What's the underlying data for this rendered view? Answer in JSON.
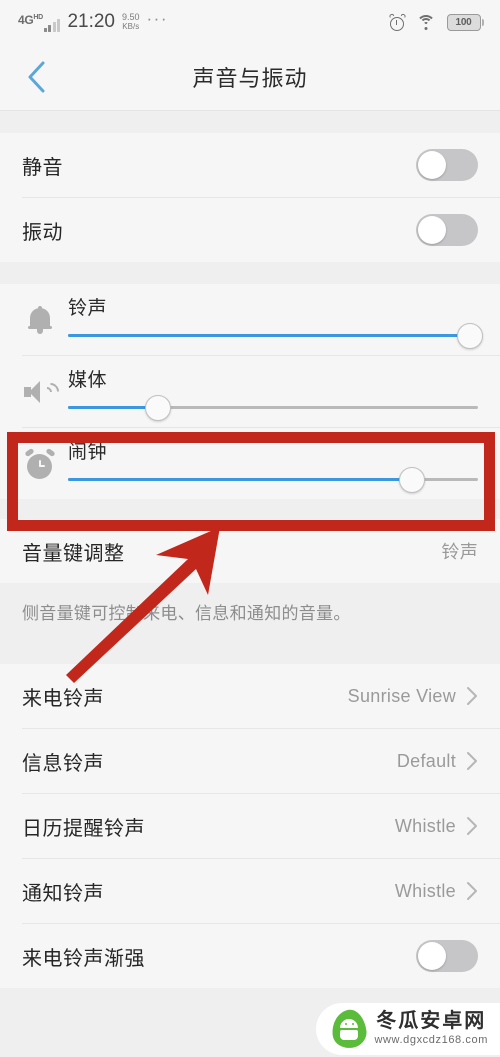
{
  "status_bar": {
    "network_type": "4G",
    "network_type_sup": "HD",
    "time": "21:20",
    "net_speed_value": "9.50",
    "net_speed_unit": "KB/s",
    "overflow_dots": "···",
    "alarm_icon": "alarm-icon",
    "wifi_icon": "wifi-icon",
    "battery_percent": "100"
  },
  "header": {
    "back_icon": "chevron-left-icon",
    "title": "声音与振动"
  },
  "toggles_group": [
    {
      "label": "静音",
      "state": "off"
    },
    {
      "label": "振动",
      "state": "off"
    }
  ],
  "sliders_group": [
    {
      "icon": "bell-icon",
      "label": "铃声",
      "percent": 98
    },
    {
      "icon": "speaker-icon",
      "label": "媒体",
      "percent": 22
    },
    {
      "icon": "alarm-clock-icon",
      "label": "闹钟",
      "percent": 84
    }
  ],
  "volume_key": {
    "label": "音量键调整",
    "value": "铃声",
    "description": "侧音量键可控制来电、信息和通知的音量。"
  },
  "ringtone_rows": [
    {
      "label": "来电铃声",
      "value": "Sunrise View",
      "chevron": "chevron-right-icon"
    },
    {
      "label": "信息铃声",
      "value": "Default",
      "chevron": "chevron-right-icon"
    },
    {
      "label": "日历提醒铃声",
      "value": "Whistle",
      "chevron": "chevron-right-icon"
    },
    {
      "label": "通知铃声",
      "value": "Whistle",
      "chevron": "chevron-right-icon"
    }
  ],
  "last_toggle": {
    "label": "来电铃声渐强",
    "state": "off"
  },
  "annotation": {
    "highlight_color": "#c1271a",
    "target": "闹钟",
    "arrow": "up-right-arrow"
  },
  "watermark": {
    "site_name": "冬瓜安卓网",
    "url": "www.dgxcdz168.com",
    "logo": "android-leaf-logo"
  },
  "theme": {
    "accent": "#3a97e0",
    "card_bg": "#f6f6f6",
    "page_bg": "#efeff0",
    "text_primary": "#262626",
    "text_secondary": "#9a9a9a"
  }
}
